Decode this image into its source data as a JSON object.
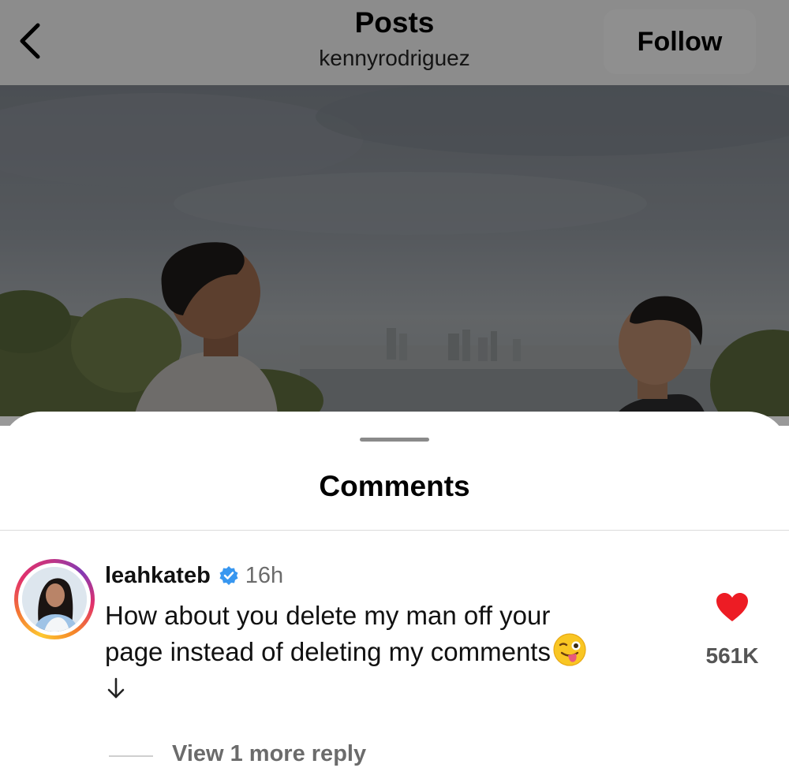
{
  "header": {
    "back_icon": "chevron-left-icon",
    "title": "Posts",
    "subtitle": "kennyrodriguez",
    "follow_label": "Follow"
  },
  "post": {
    "description": ""
  },
  "sheet": {
    "title": "Comments"
  },
  "comment": {
    "username": "leahkateb",
    "verified": true,
    "time": "16h",
    "text_line1": "How about you delete my man off your",
    "text_line2": "page instead of deleting my comments",
    "emoji": "😜",
    "like_count": "561K",
    "like_color": "#ed1c24",
    "view_replies": "View 1 more reply"
  },
  "colors": {
    "verified_blue": "#3897f0",
    "secondary_text": "#6b6b6b"
  }
}
